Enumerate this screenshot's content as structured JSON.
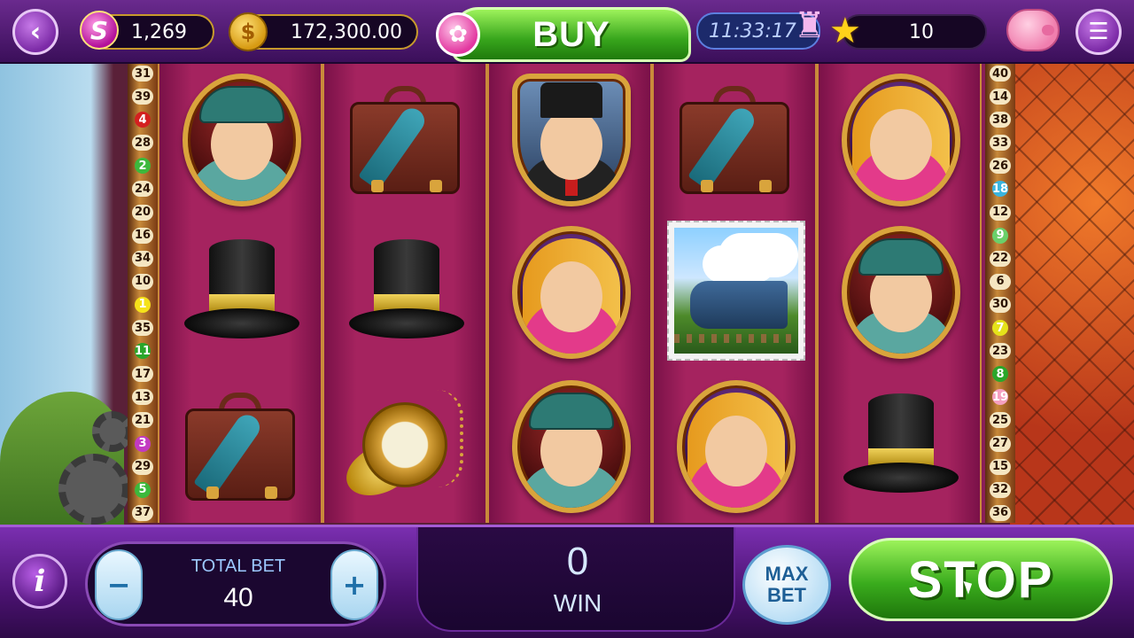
{
  "topbar": {
    "back_icon": "back-chevron-icon",
    "slots_currency_value": "1,269",
    "coins_value": "172,300.00",
    "buy_label": "BUY",
    "timer_value": "11:33:17",
    "stars_value": "10",
    "menu_icon": "hamburger-icon"
  },
  "reels": [
    {
      "symbols": [
        "chinese-man",
        "top-hat",
        "suitcase"
      ]
    },
    {
      "symbols": [
        "suitcase",
        "top-hat",
        "pocket-watch"
      ]
    },
    {
      "symbols": [
        "gentleman",
        "indian-woman",
        "chinese-man"
      ]
    },
    {
      "symbols": [
        "suitcase",
        "train-stamp",
        "indian-woman"
      ]
    },
    {
      "symbols": [
        "indian-woman",
        "chinese-man",
        "top-hat"
      ]
    }
  ],
  "paylines_left": [
    {
      "n": "31",
      "color": "#f5e6c2"
    },
    {
      "n": "39",
      "color": "#f5e6c2"
    },
    {
      "n": "4",
      "color": "#d42020"
    },
    {
      "n": "28",
      "color": "#f5e6c2"
    },
    {
      "n": "2",
      "color": "#3cb83c"
    },
    {
      "n": "24",
      "color": "#f5e6c2"
    },
    {
      "n": "20",
      "color": "#f5e6c2"
    },
    {
      "n": "16",
      "color": "#f5e6c2"
    },
    {
      "n": "34",
      "color": "#f5e6c2"
    },
    {
      "n": "10",
      "color": "#f5e6c2"
    },
    {
      "n": "1",
      "color": "#f5e21a"
    },
    {
      "n": "35",
      "color": "#f5e6c2"
    },
    {
      "n": "11",
      "color": "#2aa62a"
    },
    {
      "n": "17",
      "color": "#f5e6c2"
    },
    {
      "n": "13",
      "color": "#f5e6c2"
    },
    {
      "n": "21",
      "color": "#f5e6c2"
    },
    {
      "n": "3",
      "color": "#c23ac2"
    },
    {
      "n": "29",
      "color": "#f5e6c2"
    },
    {
      "n": "5",
      "color": "#3cb83c"
    },
    {
      "n": "37",
      "color": "#f5e6c2"
    }
  ],
  "paylines_right": [
    {
      "n": "40",
      "color": "#f5e6c2"
    },
    {
      "n": "14",
      "color": "#f5e6c2"
    },
    {
      "n": "38",
      "color": "#f5e6c2"
    },
    {
      "n": "33",
      "color": "#f5e6c2"
    },
    {
      "n": "26",
      "color": "#f5e6c2"
    },
    {
      "n": "18",
      "color": "#3ab5e0"
    },
    {
      "n": "12",
      "color": "#f5e6c2"
    },
    {
      "n": "9",
      "color": "#6ad06a"
    },
    {
      "n": "22",
      "color": "#f5e6c2"
    },
    {
      "n": "6",
      "color": "#f5e6c2"
    },
    {
      "n": "30",
      "color": "#f5e6c2"
    },
    {
      "n": "7",
      "color": "#e5e21a"
    },
    {
      "n": "23",
      "color": "#f5e6c2"
    },
    {
      "n": "8",
      "color": "#2aa62a"
    },
    {
      "n": "19",
      "color": "#f5a0c0"
    },
    {
      "n": "25",
      "color": "#f5e6c2"
    },
    {
      "n": "27",
      "color": "#f5e6c2"
    },
    {
      "n": "15",
      "color": "#f5e6c2"
    },
    {
      "n": "32",
      "color": "#f5e6c2"
    },
    {
      "n": "36",
      "color": "#f5e6c2"
    }
  ],
  "bottombar": {
    "info_label": "i",
    "minus_label": "−",
    "plus_label": "+",
    "total_bet_label": "TOTAL BET",
    "total_bet_value": "40",
    "win_value": "0",
    "win_label": "WIN",
    "max_bet_label_1": "MAX",
    "max_bet_label_2": "BET",
    "stop_label": "STOP"
  }
}
